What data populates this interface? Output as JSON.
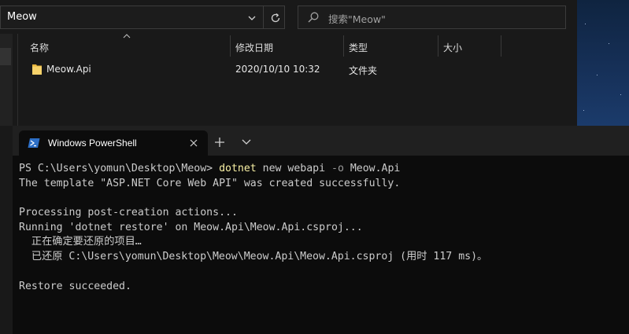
{
  "explorer": {
    "address": "Meow",
    "search_placeholder": "搜索\"Meow\"",
    "columns": {
      "name": "名称",
      "modified": "修改日期",
      "type": "类型",
      "size": "大小"
    },
    "files": [
      {
        "name": "Meow.Api",
        "modified": "2020/10/10 10:32",
        "type": "文件夹",
        "size": ""
      }
    ]
  },
  "terminal": {
    "tab_title": "Windows PowerShell",
    "prompt": "PS C:\\Users\\yomun\\Desktop\\Meow> ",
    "command": "dotnet",
    "command_args": " new webapi ",
    "command_param": "-o",
    "command_tail": " Meow.Api",
    "output": [
      "The template \"ASP.NET Core Web API\" was created successfully.",
      "",
      "Processing post-creation actions...",
      "Running 'dotnet restore' on Meow.Api\\Meow.Api.csproj...",
      "  正在确定要还原的项目…",
      "  已还原 C:\\Users\\yomun\\Desktop\\Meow\\Meow.Api\\Meow.Api.csproj (用时 117 ms)。",
      "",
      "Restore succeeded."
    ]
  },
  "colors": {
    "explorer_bg": "#191919",
    "terminal_bg": "#0c0c0c",
    "command_yellow": "#f9f1a5",
    "folder_yellow": "#f0c040",
    "ps_blue": "#2d6fc6"
  },
  "icons": [
    "chevron-down-icon",
    "refresh-icon",
    "search-icon",
    "folder-icon",
    "powershell-icon",
    "close-icon",
    "plus-icon",
    "sort-up-icon"
  ]
}
